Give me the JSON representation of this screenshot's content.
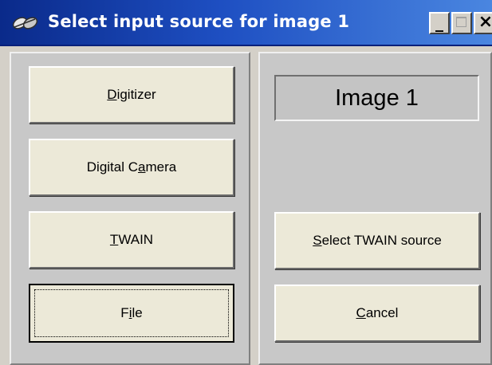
{
  "window": {
    "title": "Select input source for image 1",
    "colors": {
      "titlebar_start": "#0a2a8a",
      "titlebar_end": "#4a86e0",
      "face": "#d4d0c8",
      "button_face": "#ece9d8"
    },
    "controls": {
      "minimize_glyph": "_",
      "close_glyph": "×"
    }
  },
  "left_panel": {
    "buttons": [
      {
        "pre": "",
        "mnemonic": "D",
        "post": "igitizer"
      },
      {
        "pre": "Digital C",
        "mnemonic": "a",
        "post": "mera"
      },
      {
        "pre": "",
        "mnemonic": "T",
        "post": "WAIN"
      },
      {
        "pre": "F",
        "mnemonic": "i",
        "post": "le"
      }
    ]
  },
  "right_panel": {
    "image_label": "Image 1",
    "select_twain": {
      "pre": "",
      "mnemonic": "S",
      "post": "elect TWAIN source"
    },
    "cancel": {
      "pre": "",
      "mnemonic": "C",
      "post": "ancel"
    }
  }
}
